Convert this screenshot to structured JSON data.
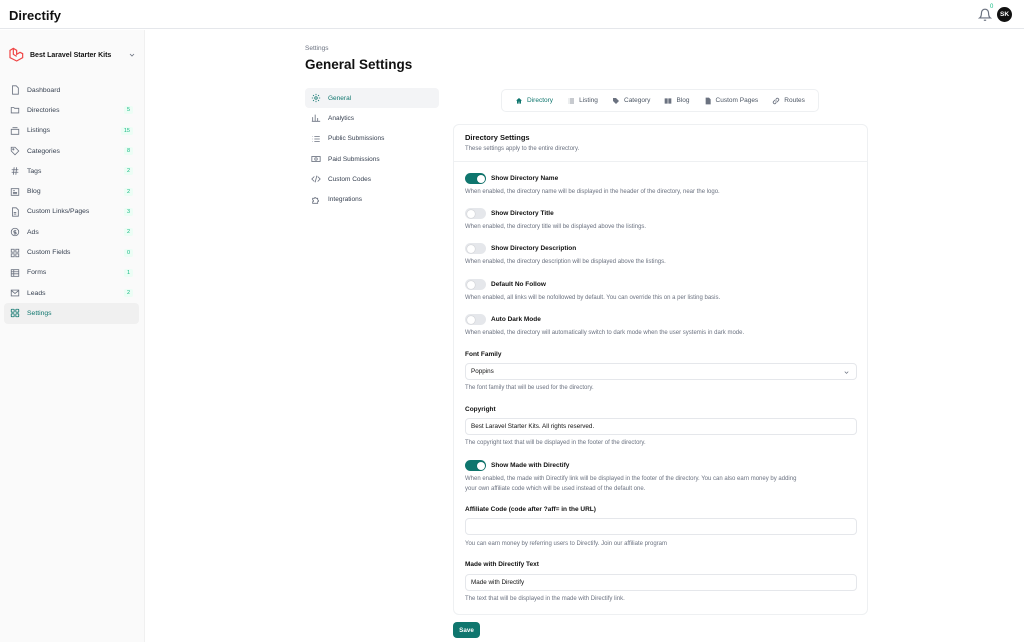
{
  "app": {
    "brand": "Directify"
  },
  "header": {
    "notification_count": "0",
    "avatar_initials": "SK"
  },
  "sidebar": {
    "site_name": "Best Laravel Starter Kits",
    "items": [
      {
        "label": "Dashboard",
        "badge": "",
        "icon": "home-icon"
      },
      {
        "label": "Directories",
        "badge": "5",
        "icon": "folder-icon"
      },
      {
        "label": "Listings",
        "badge": "15",
        "icon": "inbox-icon"
      },
      {
        "label": "Categories",
        "badge": "8",
        "icon": "tag-icon"
      },
      {
        "label": "Tags",
        "badge": "2",
        "icon": "hash-icon"
      },
      {
        "label": "Blog",
        "badge": "2",
        "icon": "newspaper-icon"
      },
      {
        "label": "Custom Links/Pages",
        "badge": "3",
        "icon": "document-icon"
      },
      {
        "label": "Ads",
        "badge": "2",
        "icon": "dollar-icon"
      },
      {
        "label": "Custom Fields",
        "badge": "0",
        "icon": "grid-icon"
      },
      {
        "label": "Forms",
        "badge": "1",
        "icon": "form-icon"
      },
      {
        "label": "Leads",
        "badge": "2",
        "icon": "mail-icon"
      },
      {
        "label": "Settings",
        "badge": "",
        "icon": "settings-grid-icon"
      }
    ]
  },
  "page": {
    "breadcrumb": "Settings",
    "title": "General Settings"
  },
  "settings_nav": [
    {
      "label": "General",
      "icon": "gear-icon"
    },
    {
      "label": "Analytics",
      "icon": "bar-chart-icon"
    },
    {
      "label": "Public Submissions",
      "icon": "list-icon"
    },
    {
      "label": "Paid Submissions",
      "icon": "money-icon"
    },
    {
      "label": "Custom Codes",
      "icon": "code-icon"
    },
    {
      "label": "Integrations",
      "icon": "puzzle-icon"
    }
  ],
  "tabs": [
    {
      "label": "Directory",
      "icon": "home-icon"
    },
    {
      "label": "Listing",
      "icon": "list-icon"
    },
    {
      "label": "Category",
      "icon": "tag-icon"
    },
    {
      "label": "Blog",
      "icon": "book-icon"
    },
    {
      "label": "Custom Pages",
      "icon": "document-icon"
    },
    {
      "label": "Routes",
      "icon": "link-icon"
    }
  ],
  "card": {
    "title": "Directory Settings",
    "subtitle": "These settings apply to the entire directory."
  },
  "toggles": [
    {
      "label": "Show Directory Name",
      "on": true,
      "help": "When enabled, the directory name will be displayed in the header of the directory, near the logo."
    },
    {
      "label": "Show Directory Title",
      "on": false,
      "help": "When enabled, the directory title will be displayed above the listings."
    },
    {
      "label": "Show Directory Description",
      "on": false,
      "help": "When enabled, the directory description will be displayed above the listings."
    },
    {
      "label": "Default No Follow",
      "on": false,
      "help": "When enabled, all links will be nofollowed by default. You can override this on a per listing basis."
    },
    {
      "label": "Auto Dark Mode",
      "on": false,
      "help": "When enabled, the directory will automatically switch to dark mode when the user systemis in dark mode."
    }
  ],
  "font_family": {
    "label": "Font Family",
    "value": "Poppins",
    "help": "The font family that will be used for the directory."
  },
  "copyright": {
    "label": "Copyright",
    "value": "Best Laravel Starter Kits. All rights reserved.",
    "help": "The copyright text that will be displayed in the footer of the directory."
  },
  "made_with": {
    "label": "Show Made with Directify",
    "on": true,
    "help_line1": "When enabled, the made with Directify link will be displayed in the footer of the directory. You can also earn money by adding",
    "help_line2": "your own affiliate code which will be used instead of the default one."
  },
  "affiliate": {
    "label": "Affiliate Code (code after ?aff= in the URL)",
    "value": "",
    "help": "You can earn money by referring users to Directify. Join our affiliate program"
  },
  "made_with_text": {
    "label": "Made with Directify Text",
    "value": "Made with Directify",
    "help": "The text that will be displayed in the made with Directify link."
  },
  "actions": {
    "save": "Save"
  },
  "colors": {
    "accent": "#0f766e",
    "badge": "#10b981"
  }
}
